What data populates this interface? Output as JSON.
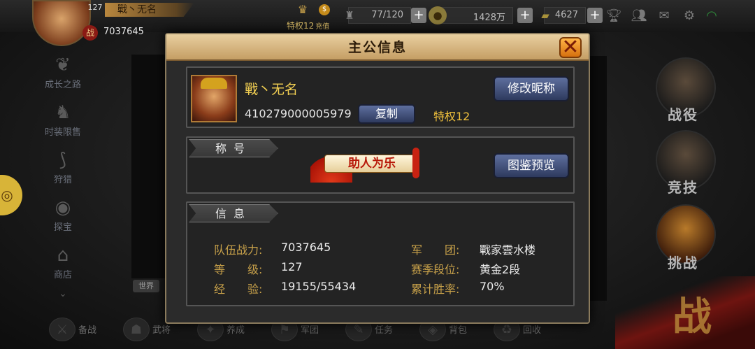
{
  "hud": {
    "player_level": "127",
    "player_name": "戰丶无名",
    "power_badge": "战",
    "power": "7037645",
    "vip_line": "特权12",
    "vip_suffix": "充值",
    "stamina": "77/120",
    "gold": "1428万",
    "ingot": "4627",
    "icons": [
      "crown-icon",
      "money-bag-icon",
      "stamina-icon",
      "gold-coin-icon",
      "ingot-icon",
      "trophy-icon",
      "friends-icon",
      "mail-icon",
      "settings-icon",
      "wifi-icon"
    ]
  },
  "side_menu": [
    {
      "label": "成长之路",
      "icon": "growth-icon"
    },
    {
      "label": "时装限售",
      "icon": "fashion-icon"
    },
    {
      "label": "狩猎",
      "icon": "bow-icon"
    },
    {
      "label": "探宝",
      "icon": "eye-icon"
    },
    {
      "label": "商店",
      "icon": "shop-icon"
    }
  ],
  "world_tag": "世界",
  "bottom_bar": [
    {
      "label": "备战",
      "icon": "crossed-swords-icon"
    },
    {
      "label": "武将",
      "icon": "general-icon"
    },
    {
      "label": "养成",
      "icon": "train-icon"
    },
    {
      "label": "军团",
      "icon": "legion-icon"
    },
    {
      "label": "任务",
      "icon": "quest-icon"
    },
    {
      "label": "背包",
      "icon": "bag-icon"
    },
    {
      "label": "回收",
      "icon": "recycle-icon"
    }
  ],
  "right_menu": [
    {
      "label": "战役"
    },
    {
      "label": "竞技"
    },
    {
      "label": "挑战"
    }
  ],
  "battle_deco_char": "战",
  "modal": {
    "title": "主公信息",
    "profile": {
      "name": "戰丶无名",
      "id": "410279000005979",
      "copy_label": "复制",
      "privilege": "特权12",
      "rename_label": "修改昵称"
    },
    "title_section": {
      "tab": "称号",
      "badge_text": "助人为乐",
      "preview_label": "图鉴预览"
    },
    "info_section": {
      "tab": "信息",
      "rows_left": [
        {
          "label": "队伍战力:",
          "value": "7037645"
        },
        {
          "label": "等　　级:",
          "value": "127"
        },
        {
          "label": "经　　验:",
          "value": "19155/55434"
        }
      ],
      "rows_right": [
        {
          "label": "军　　团:",
          "value": "戰家雲水楼"
        },
        {
          "label": "赛季段位:",
          "value": "黄金2段"
        },
        {
          "label": "累计胜率:",
          "value": "70%"
        }
      ]
    }
  },
  "colors": {
    "accent_gold": "#c9a24a",
    "name_gold": "#f2cf52",
    "button_blue": "#4a5a88",
    "header_tan": "#d8b882"
  }
}
